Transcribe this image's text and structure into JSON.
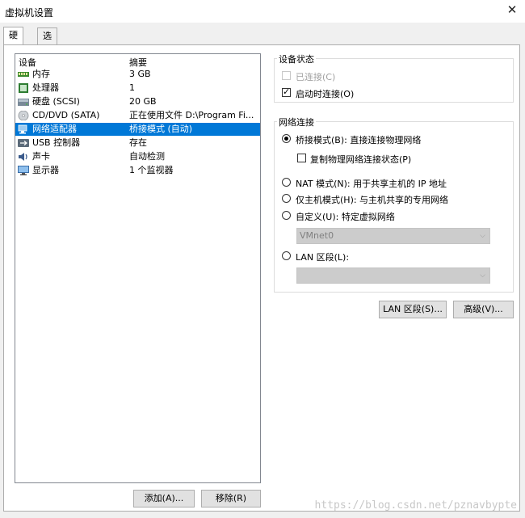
{
  "window": {
    "title": "虚拟机设置",
    "close_glyph": "✕"
  },
  "tabs": [
    {
      "label": "硬件"
    },
    {
      "label": "选项"
    }
  ],
  "device_list": {
    "columns": {
      "device": "设备",
      "summary": "摘要"
    },
    "rows": [
      {
        "name": "内存",
        "summary": "3 GB",
        "icon": "memory-icon"
      },
      {
        "name": "处理器",
        "summary": "1",
        "icon": "cpu-icon"
      },
      {
        "name": "硬盘 (SCSI)",
        "summary": "20 GB",
        "icon": "harddisk-icon"
      },
      {
        "name": "CD/DVD (SATA)",
        "summary": "正在使用文件 D:\\Program Fi...",
        "icon": "cdrom-icon"
      },
      {
        "name": "网络适配器",
        "summary": "桥接模式 (自动)",
        "icon": "network-icon",
        "selected": true
      },
      {
        "name": "USB 控制器",
        "summary": "存在",
        "icon": "usb-icon"
      },
      {
        "name": "声卡",
        "summary": "自动检测",
        "icon": "sound-icon"
      },
      {
        "name": "显示器",
        "summary": "1 个监视器",
        "icon": "monitor-icon"
      }
    ]
  },
  "buttons": {
    "add": "添加(A)...",
    "remove": "移除(R)",
    "lan_segments": "LAN 区段(S)...",
    "advanced": "高级(V)..."
  },
  "device_status": {
    "title": "设备状态",
    "connected": {
      "label": "已连接(C)",
      "checked": false,
      "enabled": false
    },
    "connect_at_power_on": {
      "label": "启动时连接(O)",
      "checked": true
    }
  },
  "network_connection": {
    "title": "网络连接",
    "bridged": {
      "label": "桥接模式(B): 直接连接物理网络",
      "selected": true
    },
    "replicate": {
      "label": "复制物理网络连接状态(P)",
      "checked": false
    },
    "nat": {
      "label": "NAT 模式(N): 用于共享主机的 IP 地址"
    },
    "host_only": {
      "label": "仅主机模式(H): 与主机共享的专用网络"
    },
    "custom": {
      "label": "自定义(U): 特定虚拟网络"
    },
    "custom_combo": {
      "value": "VMnet0"
    },
    "lan_segment": {
      "label": "LAN 区段(L):"
    },
    "lan_combo": {
      "value": ""
    }
  },
  "watermark": "https://blog.csdn.net/pznavbypte"
}
